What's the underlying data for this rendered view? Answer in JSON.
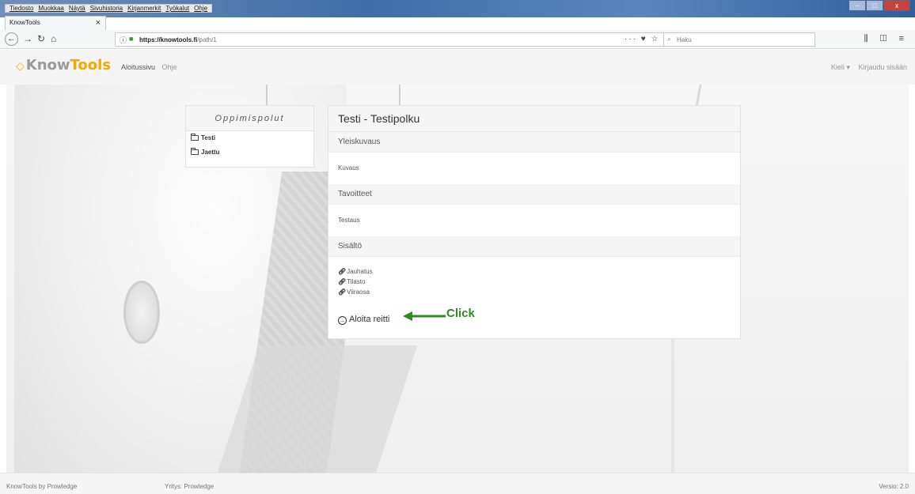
{
  "browser": {
    "menu": [
      "Tiedosto",
      "Muokkaa",
      "Näytä",
      "Sivuhistoria",
      "Kirjanmerkit",
      "Työkalut",
      "Ohje"
    ],
    "tab_title": "KnowTools",
    "tab_close": "×",
    "new_tab": "+",
    "url_host": "https://knowtools.fi",
    "url_path": "/path/1",
    "url_actions": "··· ♥ ☆",
    "search_placeholder": "Haku"
  },
  "header": {
    "logo_know": "Know",
    "logo_tools": "Tools",
    "nav": [
      "Aloitussivu",
      "Ohje"
    ],
    "language": "Kieli ▾",
    "login": "Kirjaudu sisään"
  },
  "sidebar": {
    "title": "Oppimispolut",
    "items": [
      {
        "label": "Testi"
      },
      {
        "label": "Jaettu"
      }
    ]
  },
  "main": {
    "title": "Testi - Testipolku",
    "overview_heading": "Yleiskuvaus",
    "overview_text": "Kuvaus",
    "goals_heading": "Tavoitteet",
    "goals_text": "Testaus",
    "content_heading": "Sisältö",
    "content_links": [
      {
        "label": "Jauhatus"
      },
      {
        "label": "Tilasto"
      },
      {
        "label": "Viiraosa"
      }
    ],
    "start_label": "Aloita reitti"
  },
  "annotation": {
    "text": "Click",
    "color": "#2e8b22"
  },
  "footer": {
    "left": "KnowTools by Prowledge",
    "middle": "Yritys: Prowledge",
    "right": "Versio: 2.0"
  }
}
